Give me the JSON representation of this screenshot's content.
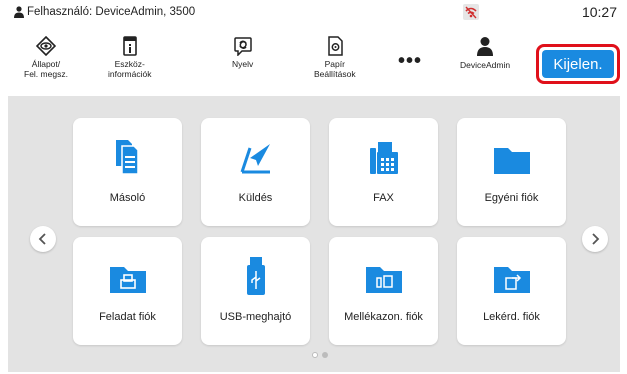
{
  "status": {
    "user_text": "Felhasználó: DeviceAdmin, 3500",
    "time": "10:27"
  },
  "toolbar": {
    "status": "Állapot/\nFel. megsz.",
    "status_l1": "Állapot/",
    "status_l2": "Fel. megsz.",
    "device_l1": "Eszköz-",
    "device_l2": "információk",
    "language": "Nyelv",
    "paper_l1": "Papír",
    "paper_l2": "Beállítások",
    "more": "•••",
    "user": "DeviceAdmin",
    "logout": "Kijelen."
  },
  "tiles": [
    {
      "label": "Másoló",
      "icon": "copy-icon"
    },
    {
      "label": "Küldés",
      "icon": "send-icon"
    },
    {
      "label": "FAX",
      "icon": "fax-icon"
    },
    {
      "label": "Egyéni fiók",
      "icon": "folder-icon"
    },
    {
      "label": "Feladat fiók",
      "icon": "job-box-icon"
    },
    {
      "label": "USB-meghajtó",
      "icon": "usb-icon"
    },
    {
      "label": "Mellékazon. fiók",
      "icon": "subaddress-box-icon"
    },
    {
      "label": "Lekérd. fiók",
      "icon": "polling-box-icon"
    }
  ],
  "pager": {
    "pages": 2,
    "current": 1
  },
  "colors": {
    "accent": "#1a8ae0",
    "highlight_border": "#e0101a",
    "icon_blue": "#1a8ae0",
    "background": "#e3e3e3"
  }
}
